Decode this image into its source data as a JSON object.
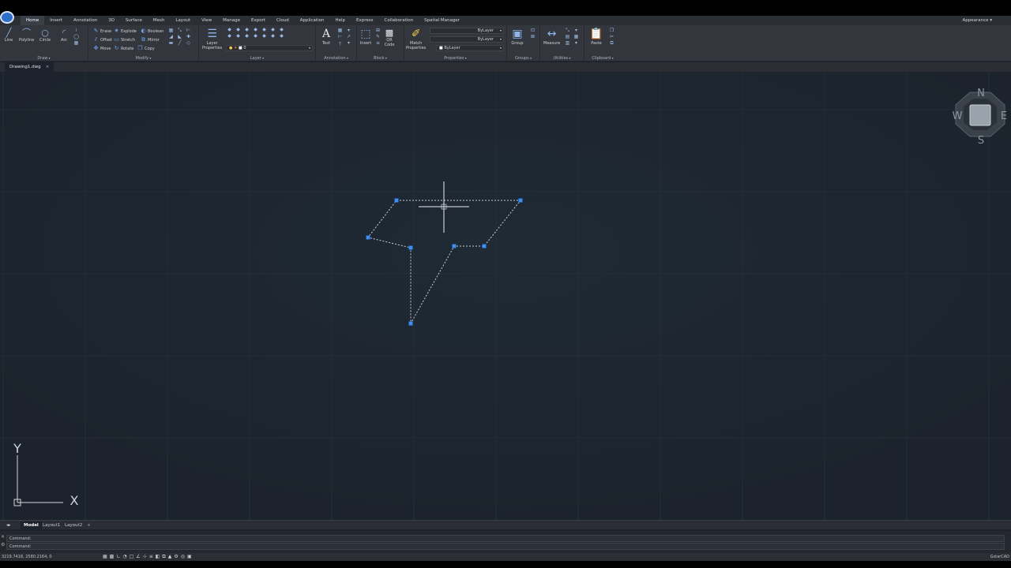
{
  "menu": {
    "items": [
      "Home",
      "Insert",
      "Annotation",
      "3D",
      "Surface",
      "Mesh",
      "Layout",
      "View",
      "Manage",
      "Export",
      "Cloud",
      "Application",
      "Help",
      "Express",
      "Collaboration",
      "Spatial Manager"
    ],
    "active_index": 0,
    "appearance": "Appearance"
  },
  "ribbon": {
    "draw": {
      "title": "Draw",
      "line": "Line",
      "polyline": "Polyline",
      "circle": "Circle",
      "arc": "Arc"
    },
    "modify": {
      "title": "Modify",
      "erase": "Erase",
      "explode": "Explode",
      "boolean": "Boolean",
      "offset": "Offset",
      "stretch": "Stretch",
      "mirror": "Mirror",
      "move": "Move",
      "rotate": "Rotate",
      "copy": "Copy"
    },
    "layer": {
      "title": "Layer",
      "layer_properties_1": "Layer",
      "layer_properties_2": "Properties",
      "current_layer": "0"
    },
    "annotation": {
      "title": "Annotation",
      "text": "Text"
    },
    "block": {
      "title": "Block",
      "insert": "Insert",
      "qr_1": "QR",
      "qr_2": "Code"
    },
    "properties": {
      "title": "Properties",
      "match_1": "Match",
      "match_2": "Properties",
      "bylayer_1": "ByLayer",
      "bylayer_2": "ByLayer",
      "bylayer_3": "ByLayer"
    },
    "groups": {
      "title": "Groups",
      "group": "Group"
    },
    "utilities": {
      "title": "Utilities",
      "measure": "Measure"
    },
    "clipboard": {
      "title": "Clipboard",
      "paste": "Paste"
    }
  },
  "document": {
    "tab": "Drawing1.dwg",
    "close": "×"
  },
  "viewcube": {
    "n": "N",
    "s": "S",
    "e": "E",
    "w": "W"
  },
  "ucs": {
    "x": "X",
    "y": "Y"
  },
  "layout_tabs": {
    "model": "Model",
    "layout1": "Layout1",
    "layout2": "Layout2",
    "add": "+"
  },
  "command": {
    "line1": "Command:",
    "line2": "Command:"
  },
  "status": {
    "coords": "3219.7418, 2580.2164, 0",
    "brand": "GstarCAD"
  },
  "colors": {
    "canvas": "#1e2630",
    "grip": "#3d8ff0",
    "geometry": "#c8d0d8",
    "accent": "#2f6ec8"
  }
}
